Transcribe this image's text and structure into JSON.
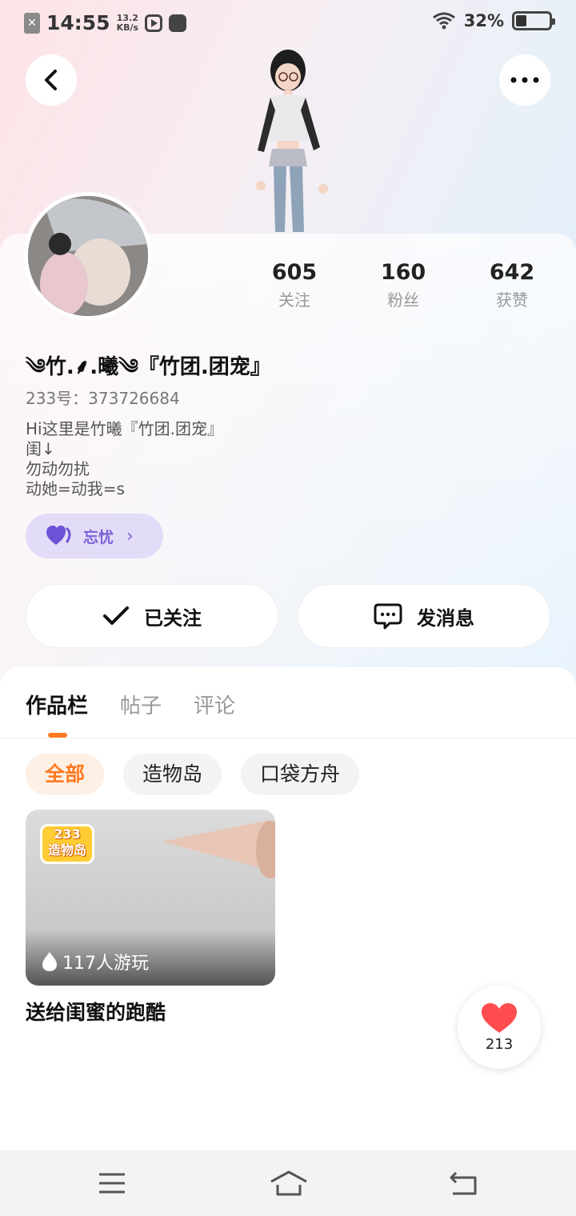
{
  "status_bar": {
    "time": "14:55",
    "net_speed_value": "13.2",
    "net_speed_unit": "KB/s",
    "battery_percent": "32%",
    "battery_level": 0.32
  },
  "header": {
    "back_icon": "chevron-left-icon",
    "more_icon": "more-dots-icon"
  },
  "profile": {
    "stats": [
      {
        "value": "605",
        "label": "关注"
      },
      {
        "value": "160",
        "label": "粉丝"
      },
      {
        "value": "642",
        "label": "获赞"
      }
    ],
    "nickname": "༄竹.⸙.曦༄『竹团.团宠』",
    "uid": "233号：373726684",
    "bio_lines": [
      "Hi这里是竹曦『竹团.团宠』",
      "闺↓",
      "勿动勿扰",
      "动她=动我=s"
    ],
    "tag": {
      "label": "忘忧",
      "icon": "heart-badge-icon",
      "color": "#7b62d8"
    }
  },
  "actions": {
    "follow_label": "已关注",
    "message_label": "发消息"
  },
  "tabs": [
    {
      "label": "作品栏",
      "active": true
    },
    {
      "label": "帖子",
      "active": false
    },
    {
      "label": "评论",
      "active": false
    }
  ],
  "filters": [
    {
      "label": "全部",
      "active": true
    },
    {
      "label": "造物岛",
      "active": false
    },
    {
      "label": "口袋方舟",
      "active": false
    }
  ],
  "works": [
    {
      "title": "送给闺蜜的跑酷",
      "play_count": "117人游玩",
      "logo_text_1": "233",
      "logo_text_2": "造物岛"
    }
  ],
  "like": {
    "count": "213"
  },
  "colors": {
    "accent": "#ff7a21",
    "tag": "#7b62d8",
    "like": "#ff4d4f"
  }
}
